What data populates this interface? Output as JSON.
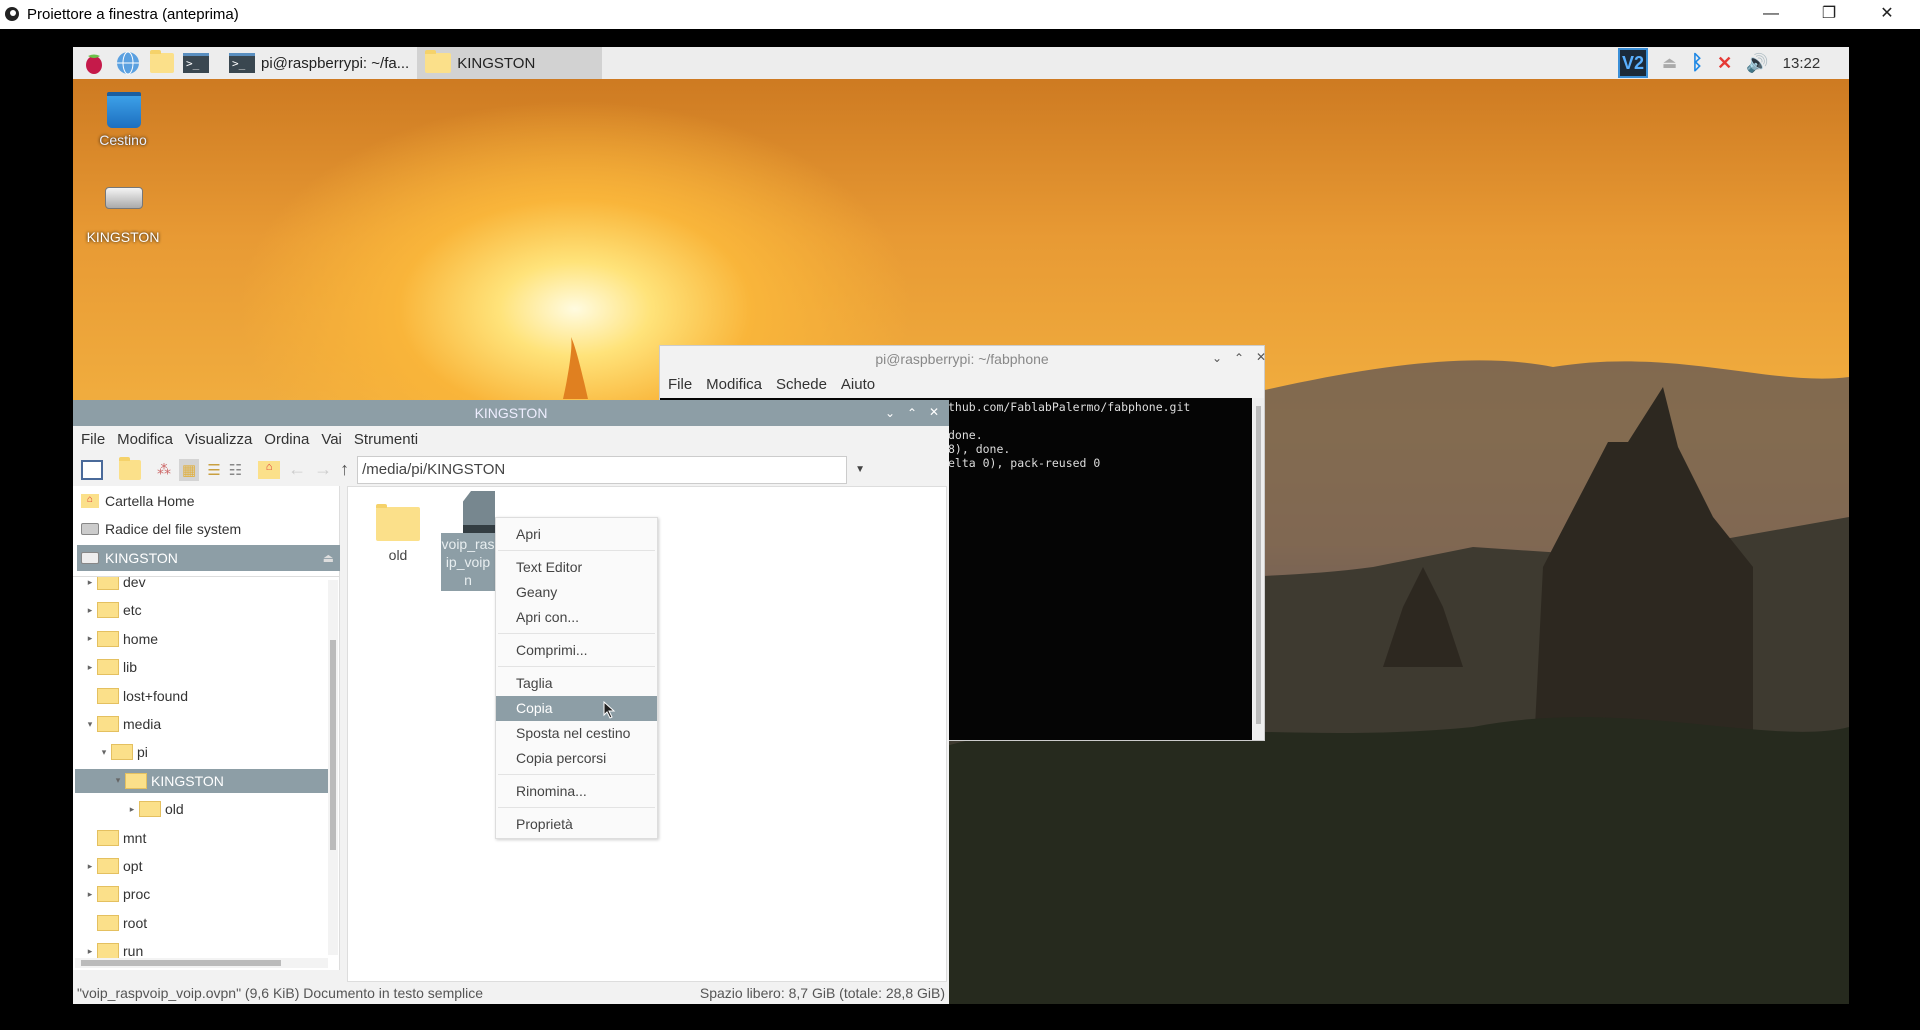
{
  "window": {
    "title": "Proiettore a finestra (anteprima)",
    "minimize": "—",
    "restore": "❐",
    "close": "✕"
  },
  "taskbar": {
    "tasks": [
      {
        "label": "pi@raspberrypi: ~/fa..."
      },
      {
        "label": "KINGSTON"
      }
    ],
    "clock": "13:22",
    "tray_icons": [
      "vnc-icon",
      "eject-icon",
      "bluetooth-icon",
      "network-disconnected-icon",
      "volume-icon"
    ]
  },
  "desktop": {
    "icons": [
      {
        "label": "Cestino",
        "icon": "trash-icon"
      },
      {
        "label": "KINGSTON",
        "icon": "drive-icon"
      }
    ]
  },
  "terminal": {
    "title": "pi@raspberrypi: ~/fabphone",
    "menu": [
      "File",
      "Modifica",
      "Schede",
      "Aiuto"
    ],
    "lines": [
      "thub.com/FablabPalermo/fabphone.git",
      "",
      "",
      " done.",
      "8), done.",
      "elta 0), pack-reused 0"
    ]
  },
  "filemanager": {
    "title": "KINGSTON",
    "menu": [
      "File",
      "Modifica",
      "Visualizza",
      "Ordina",
      "Vai",
      "Strumenti"
    ],
    "path": "/media/pi/KINGSTON",
    "places": [
      {
        "label": "Cartella Home"
      },
      {
        "label": "Radice del file system"
      },
      {
        "label": "KINGSTON"
      }
    ],
    "tree": [
      {
        "label": "dev",
        "depth": 0,
        "exp": "▸"
      },
      {
        "label": "etc",
        "depth": 0,
        "exp": "▸"
      },
      {
        "label": "home",
        "depth": 0,
        "exp": "▸"
      },
      {
        "label": "lib",
        "depth": 0,
        "exp": "▸"
      },
      {
        "label": "lost+found",
        "depth": 0,
        "exp": ""
      },
      {
        "label": "media",
        "depth": 0,
        "exp": "▾"
      },
      {
        "label": "pi",
        "depth": 1,
        "exp": "▾"
      },
      {
        "label": "KINGSTON",
        "depth": 2,
        "exp": "▾",
        "selected": true
      },
      {
        "label": "old",
        "depth": 3,
        "exp": "▸"
      },
      {
        "label": "mnt",
        "depth": 0,
        "exp": ""
      },
      {
        "label": "opt",
        "depth": 0,
        "exp": "▸"
      },
      {
        "label": "proc",
        "depth": 0,
        "exp": "▸"
      },
      {
        "label": "root",
        "depth": 0,
        "exp": ""
      },
      {
        "label": "run",
        "depth": 0,
        "exp": "▸"
      }
    ],
    "files": [
      {
        "label": "old"
      },
      {
        "label": "voip_raspvoip_voip.ovpn",
        "label_visible": [
          "voip_ras",
          "ip_voip",
          "n"
        ]
      }
    ],
    "status_left": "\"voip_raspvoip_voip.ovpn\" (9,6 KiB) Documento in testo semplice",
    "status_right": "Spazio libero: 8,7 GiB (totale: 28,8 GiB)"
  },
  "context_menu": {
    "items": [
      {
        "label": "Apri",
        "sep": true
      },
      {
        "label": "Text Editor"
      },
      {
        "label": "Geany"
      },
      {
        "label": "Apri con...",
        "sep": true
      },
      {
        "label": "Comprimi...",
        "sep": true
      },
      {
        "label": "Taglia"
      },
      {
        "label": "Copia",
        "highlighted": true
      },
      {
        "label": "Sposta nel cestino"
      },
      {
        "label": "Copia percorsi",
        "sep": true
      },
      {
        "label": "Rinomina...",
        "sep": true
      },
      {
        "label": "Proprietà"
      }
    ]
  },
  "colors": {
    "selection": "#8d9ea6",
    "folder": "#fbe08a",
    "bluetooth": "#1e88e5",
    "network_error": "#e53935"
  }
}
